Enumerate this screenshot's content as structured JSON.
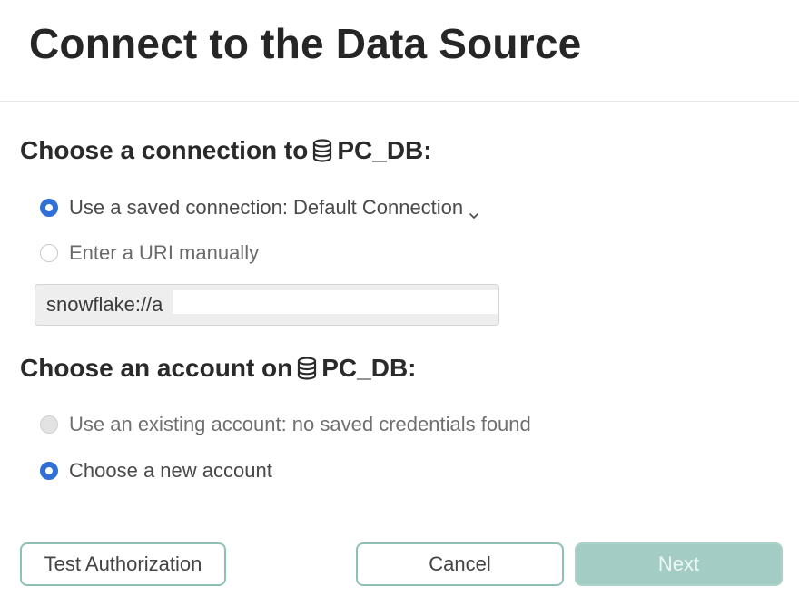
{
  "dialog": {
    "title": "Connect to the Data Source"
  },
  "connection_section": {
    "heading_prefix": "Choose a connection to",
    "db_name": "PC_DB",
    "heading_suffix": ":",
    "options": {
      "saved": {
        "label": "Use a saved connection: Default Connection",
        "selected": true
      },
      "manual": {
        "label": "Enter a URI manually",
        "selected": false
      }
    },
    "uri_value": "snowflake://a"
  },
  "account_section": {
    "heading_prefix": "Choose an account on",
    "db_name": "PC_DB",
    "heading_suffix": ":",
    "options": {
      "existing": {
        "label": "Use an existing account: no saved credentials found",
        "selected": false,
        "disabled": true
      },
      "new": {
        "label": "Choose a new account",
        "selected": true
      }
    }
  },
  "footer": {
    "test_button": "Test Authorization",
    "cancel_button": "Cancel",
    "next_button": "Next"
  },
  "colors": {
    "accent_radio": "#2f6fd6",
    "button_border": "#8fc0b6",
    "next_disabled_bg": "#a3cdc4"
  }
}
